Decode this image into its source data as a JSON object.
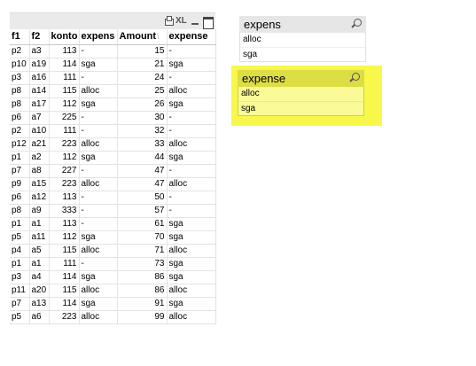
{
  "table": {
    "toolbar": {
      "xl_label": "XL"
    },
    "columns": [
      "f1",
      "f2",
      "konto",
      "expens",
      "Amount",
      "expense"
    ],
    "sort_indicator": "\\",
    "rows": [
      [
        "p2",
        "a3",
        "113",
        "-",
        "15",
        "-"
      ],
      [
        "p10",
        "a19",
        "114",
        "sga",
        "21",
        "sga"
      ],
      [
        "p3",
        "a16",
        "111",
        "-",
        "24",
        "-"
      ],
      [
        "p8",
        "a14",
        "115",
        "alloc",
        "25",
        "alloc"
      ],
      [
        "p8",
        "a17",
        "112",
        "sga",
        "26",
        "sga"
      ],
      [
        "p6",
        "a7",
        "225",
        "-",
        "30",
        "-"
      ],
      [
        "p2",
        "a10",
        "111",
        "-",
        "32",
        "-"
      ],
      [
        "p12",
        "a21",
        "223",
        "alloc",
        "33",
        "alloc"
      ],
      [
        "p1",
        "a2",
        "112",
        "sga",
        "44",
        "sga"
      ],
      [
        "p7",
        "a8",
        "227",
        "-",
        "47",
        "-"
      ],
      [
        "p9",
        "a15",
        "223",
        "alloc",
        "47",
        "alloc"
      ],
      [
        "p6",
        "a12",
        "113",
        "-",
        "50",
        "-"
      ],
      [
        "p8",
        "a9",
        "333",
        "-",
        "57",
        "-"
      ],
      [
        "p1",
        "a1",
        "113",
        "-",
        "61",
        "sga"
      ],
      [
        "p5",
        "a11",
        "112",
        "sga",
        "70",
        "sga"
      ],
      [
        "p4",
        "a5",
        "115",
        "alloc",
        "71",
        "alloc"
      ],
      [
        "p1",
        "a1",
        "111",
        "-",
        "73",
        "sga"
      ],
      [
        "p3",
        "a4",
        "114",
        "sga",
        "86",
        "sga"
      ],
      [
        "p11",
        "a20",
        "115",
        "alloc",
        "86",
        "alloc"
      ],
      [
        "p7",
        "a13",
        "114",
        "sga",
        "91",
        "sga"
      ],
      [
        "p5",
        "a6",
        "223",
        "alloc",
        "99",
        "alloc"
      ]
    ]
  },
  "listbox_expens": {
    "title": "expens",
    "items": [
      "alloc",
      "sga"
    ]
  },
  "listbox_expense": {
    "title": "expense",
    "items": [
      "alloc",
      "sga"
    ],
    "highlight_color": "#f7f74c"
  }
}
